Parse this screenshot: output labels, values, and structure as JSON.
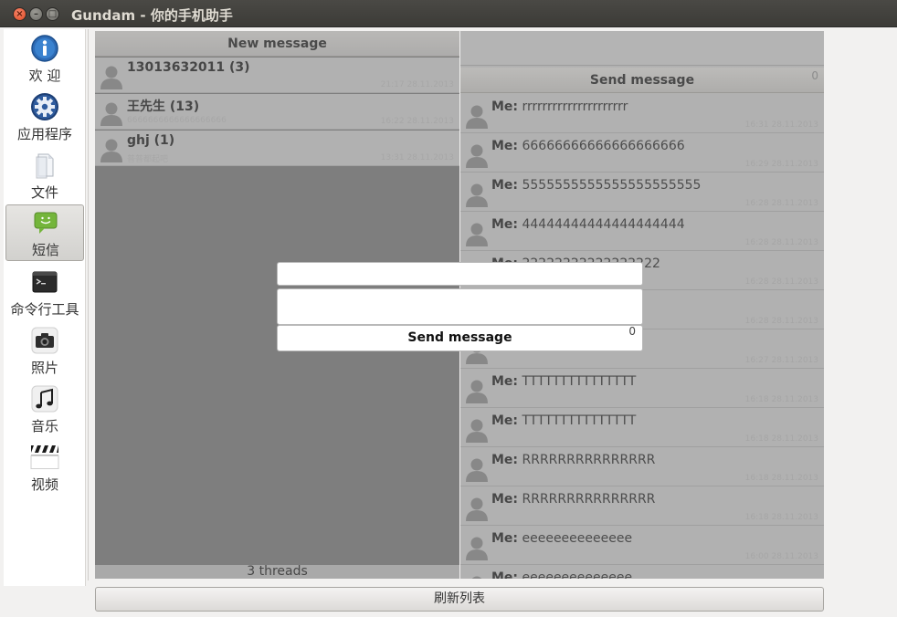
{
  "window": {
    "title": "Gundam - 你的手机助手"
  },
  "sidebar": {
    "items": [
      {
        "label": "欢 迎",
        "icon": "info-icon"
      },
      {
        "label": "应用程序",
        "icon": "gear-icon"
      },
      {
        "label": "文件",
        "icon": "document-icon"
      },
      {
        "label": "短信",
        "icon": "chat-bubble-icon",
        "active": true
      },
      {
        "label": "命令行工具",
        "icon": "terminal-icon"
      },
      {
        "label": "照片",
        "icon": "camera-icon"
      },
      {
        "label": "音乐",
        "icon": "music-note-icon"
      },
      {
        "label": "视频",
        "icon": "clapperboard-icon"
      }
    ]
  },
  "threads": {
    "new_message_label": "New message",
    "items": [
      {
        "name": "13013632011 (3)",
        "snippet": "",
        "time": "21:17 28.11.2013"
      },
      {
        "name": "王先生 (13)",
        "snippet": "6666666666666666666",
        "time": "16:22 28.11.2013"
      },
      {
        "name": "ghj (1)",
        "snippet": "普普都起吧",
        "time": "13:31 28.11.2013"
      }
    ],
    "footer": "3 threads"
  },
  "messages": {
    "send_label": "Send message",
    "count": "0",
    "sender_label": "Me:",
    "items": [
      {
        "text": "rrrrrrrrrrrrrrrrrrrrr",
        "time": "16:31 28.11.2013"
      },
      {
        "text": "66666666666666666666",
        "time": "16:29 28.11.2013"
      },
      {
        "text": "5555555555555555555555",
        "time": "16:28 28.11.2013"
      },
      {
        "text": "44444444444444444444",
        "time": "16:28 28.11.2013"
      },
      {
        "text": "22222222222222222",
        "time": "16:28 28.11.2013"
      },
      {
        "text": "",
        "time": "16:28 28.11.2013"
      },
      {
        "text": "",
        "time": "16:27 28.11.2013"
      },
      {
        "text": "TTTTTTTTTTTTTTT",
        "time": "16:18 28.11.2013"
      },
      {
        "text": "TTTTTTTTTTTTTTT",
        "time": "16:18 28.11.2013"
      },
      {
        "text": "RRRRRRRRRRRRRRR",
        "time": "16:18 28.11.2013"
      },
      {
        "text": "RRRRRRRRRRRRRRR",
        "time": "16:18 28.11.2013"
      },
      {
        "text": "eeeeeeeeeeeeee",
        "time": "16:00 28.11.2013"
      },
      {
        "text": "eeeeeeeeeeeeee",
        "time": ""
      }
    ]
  },
  "dialog": {
    "number_value": "",
    "body_value": "",
    "send_label": "Send message",
    "count": "0"
  },
  "refresh_label": "刷新列表"
}
